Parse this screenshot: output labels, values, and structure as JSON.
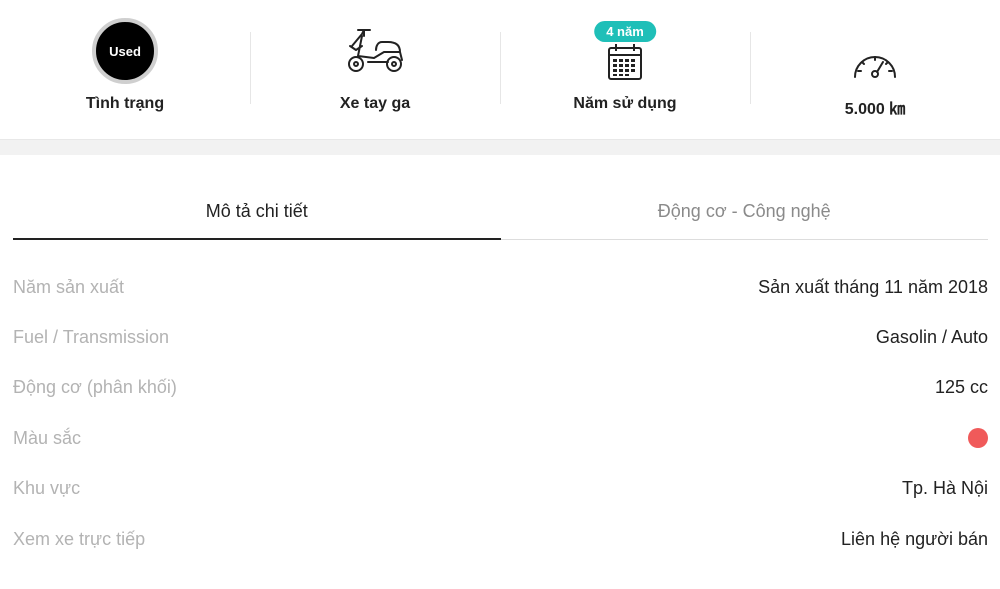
{
  "specs": {
    "condition": {
      "badge": "Used",
      "label": "Tình trạng"
    },
    "type": {
      "label": "Xe tay ga",
      "icon": "scooter-icon"
    },
    "usage": {
      "pill": "4 năm",
      "label": "Năm sử dụng",
      "icon": "calendar-icon"
    },
    "mileage": {
      "label": "5.000 ㎞",
      "icon": "speedometer-icon"
    }
  },
  "tabs": [
    {
      "label": "Mô tả chi tiết",
      "active": true
    },
    {
      "label": "Động cơ - Công nghệ",
      "active": false
    }
  ],
  "details": [
    {
      "label": "Năm sản xuất",
      "value": "Sản xuất tháng 11 năm 2018"
    },
    {
      "label": "Fuel / Transmission",
      "value": "Gasolin / Auto"
    },
    {
      "label": "Động cơ (phân khối)",
      "value": "125 cc"
    },
    {
      "label": "Màu sắc",
      "color": "#f05a5a"
    },
    {
      "label": "Khu vực",
      "value": "Tp. Hà Nội"
    },
    {
      "label": "Xem xe trực tiếp",
      "value": "Liên hệ người bán"
    }
  ],
  "colors": {
    "accent_teal": "#1fbfb8",
    "swatch_red": "#f05a5a"
  }
}
